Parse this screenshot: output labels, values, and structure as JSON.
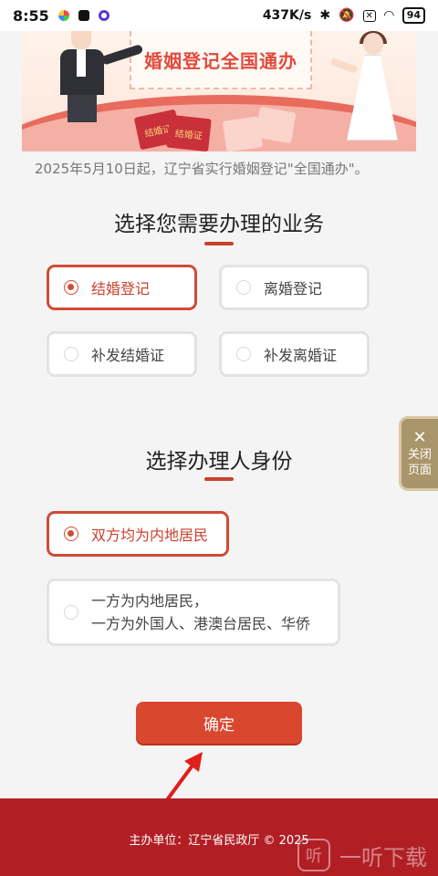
{
  "status_bar": {
    "time": "8:55",
    "speed": "437K/s",
    "battery": "94"
  },
  "banner": {
    "title": "婚姻登记全国通办",
    "cert_text": "结婚证"
  },
  "notice": "2025年5月10日起，辽宁省实行婚姻登记\"全国通办\"。",
  "business": {
    "title": "选择您需要办理的业务",
    "options": [
      "结婚登记",
      "离婚登记",
      "补发结婚证",
      "补发离婚证"
    ],
    "selected": "结婚登记"
  },
  "identity": {
    "title": "选择办理人身份",
    "option1": "双方均为内地居民",
    "option2_line1": "一方为内地居民，",
    "option2_line2": "一方为外国人、港澳台居民、华侨",
    "selected": "双方均为内地居民"
  },
  "close_tab": {
    "line1": "关闭",
    "line2": "页面"
  },
  "confirm_label": "确定",
  "footer": {
    "sponsor": "主办单位：辽宁省民政厅 © 2025",
    "watermark": "一听下载"
  },
  "colors": {
    "accent": "#d9472f",
    "footer_bg": "#b11f25",
    "close_tab_bg": "#a9956a"
  }
}
